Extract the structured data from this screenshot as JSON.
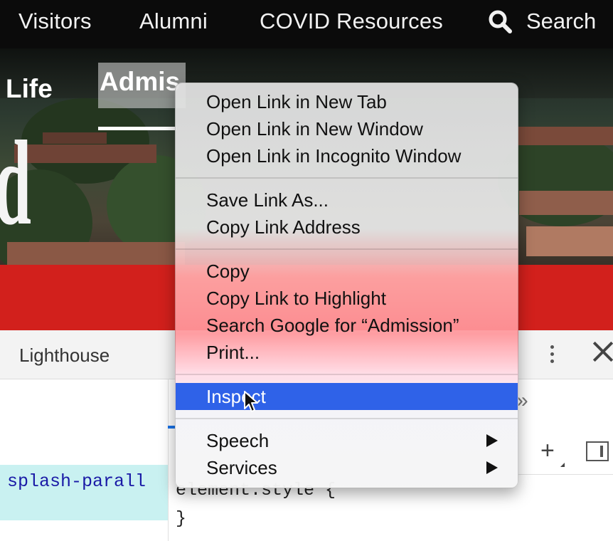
{
  "top_nav": {
    "items": [
      "Visitors",
      "Alumni",
      "COVID Resources"
    ],
    "search_label": "Search"
  },
  "hero": {
    "nav_items": [
      "Life",
      "Admis"
    ],
    "big_letter": "d"
  },
  "devtools": {
    "tab_label": "Lighthouse",
    "dom_node_text": "splash-parall",
    "style_rule_open": "element.style {",
    "style_rule_close": "}",
    "more_tabs_glyph": "»",
    "plus_glyph": "+"
  },
  "context_menu": {
    "groups": [
      [
        "Open Link in New Tab",
        "Open Link in New Window",
        "Open Link in Incognito Window"
      ],
      [
        "Save Link As...",
        "Copy Link Address"
      ],
      [
        "Copy",
        "Copy Link to Highlight",
        "Search Google for “Admission”",
        "Print..."
      ],
      [
        "Inspect"
      ],
      [
        "Speech",
        "Services"
      ]
    ],
    "highlighted_item": "Inspect"
  },
  "colors": {
    "header_bg": "#0b0b0b",
    "red_band": "#d2201c",
    "menu_highlight": "#2f62e8",
    "dom_highlight": "#c9f1f1"
  },
  "icons": {
    "search": "search-icon",
    "kebab": "kebab-menu-icon",
    "close": "close-icon",
    "submenu": "submenu-arrow-icon",
    "cursor": "mouse-pointer-icon"
  }
}
